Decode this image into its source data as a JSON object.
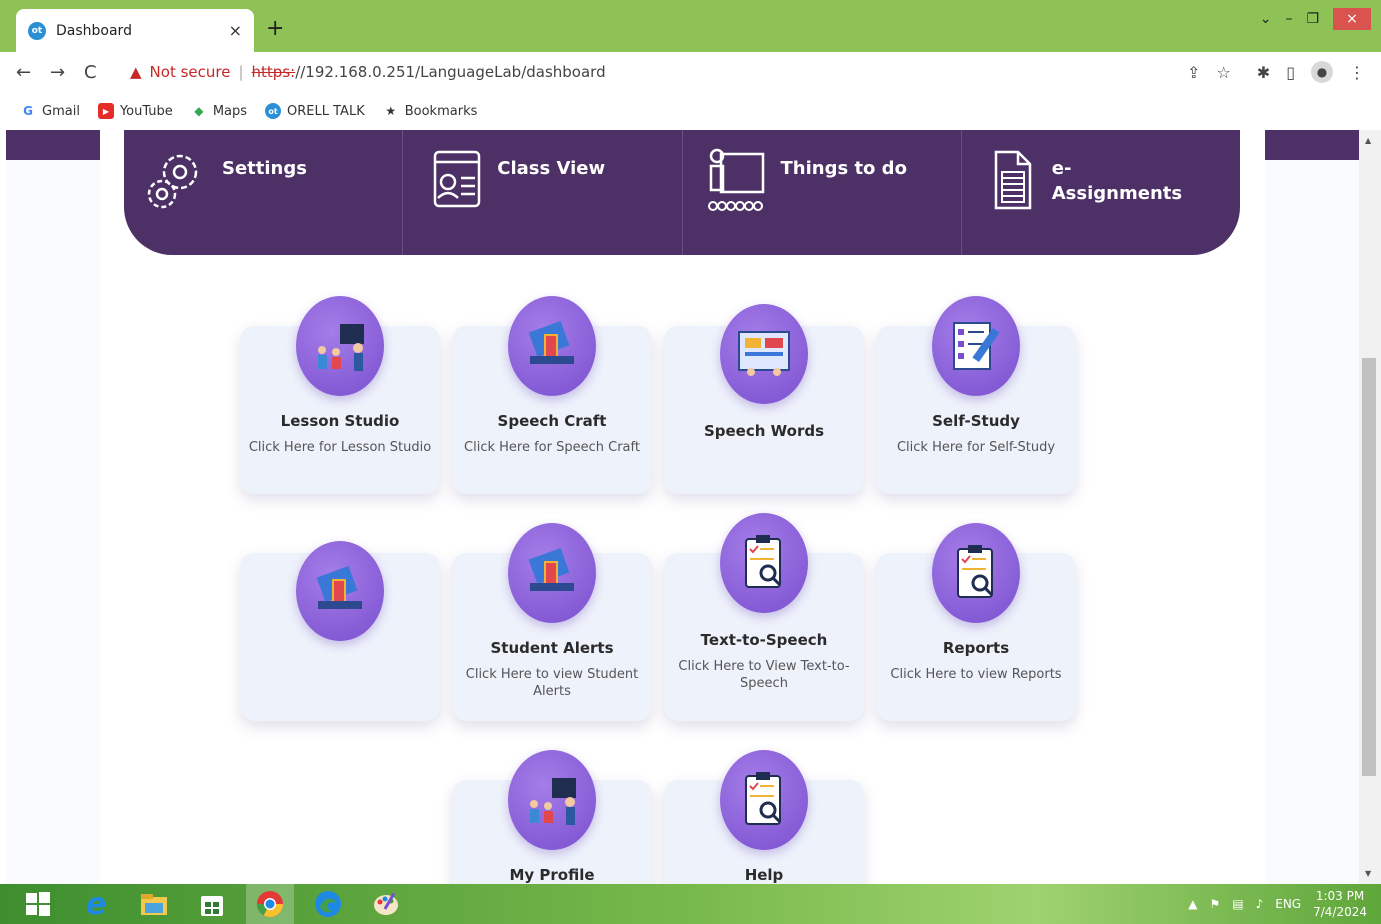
{
  "browser": {
    "tab_title": "Dashboard",
    "tab_close": "×",
    "new_tab": "+",
    "window_controls": {
      "dropdown": "⌄",
      "minimize": "–",
      "restore": "❐",
      "close": "×"
    },
    "url_warning_icon": "▲",
    "not_secure": "Not secure",
    "url_separator": "|",
    "url_scheme": "https:",
    "url_rest": "//192.168.0.251/LanguageLab/dashboard",
    "nav": {
      "back": "←",
      "forward": "→",
      "reload": "C"
    },
    "right_icons": {
      "share": "⇪",
      "star": "☆",
      "extensions": "✱",
      "sidepanel": "▯",
      "menu": "⋮"
    },
    "bookmarks": [
      {
        "label": "Gmail",
        "icon": "G",
        "color": "#4285f4"
      },
      {
        "label": "YouTube",
        "icon": "▶",
        "color": "#e52d27"
      },
      {
        "label": "Maps",
        "icon": "◆",
        "color": "#34a853"
      },
      {
        "label": "ORELL TALK",
        "icon": "ot",
        "color": "#2b8fd6"
      },
      {
        "label": "Bookmarks",
        "icon": "★",
        "color": "#333333"
      }
    ]
  },
  "nav_band": {
    "items": [
      {
        "label": "Settings",
        "icon": "settings-icon"
      },
      {
        "label": "Class View",
        "icon": "class-view-icon"
      },
      {
        "label": "Things to do",
        "icon": "things-to-do-icon"
      },
      {
        "label": "e-Assignments",
        "icon": "e-assignments-icon"
      }
    ]
  },
  "cards": [
    {
      "title": "Lesson Studio",
      "subtitle": "Click Here for Lesson Studio",
      "icon": "lesson-studio-icon"
    },
    {
      "title": "Speech Craft",
      "subtitle": "Click Here for Speech Craft",
      "icon": "speech-craft-icon"
    },
    {
      "title": "Speech Words",
      "subtitle": "",
      "icon": "speech-words-icon"
    },
    {
      "title": "Self-Study",
      "subtitle": "Click Here for Self-Study",
      "icon": "self-study-icon"
    },
    {
      "title": "",
      "subtitle": "",
      "icon": "laptop-door-icon"
    },
    {
      "title": "Student Alerts",
      "subtitle": "Click Here to view Student Alerts",
      "icon": "student-alerts-icon"
    },
    {
      "title": "Text-to-Speech",
      "subtitle": "Click Here to View Text-to-Speech",
      "icon": "text-to-speech-icon"
    },
    {
      "title": "Reports",
      "subtitle": "Click Here to view Reports",
      "icon": "reports-icon"
    },
    {
      "title": "My Profile",
      "subtitle": "",
      "icon": "my-profile-icon"
    },
    {
      "title": "Help",
      "subtitle": "",
      "icon": "help-icon"
    }
  ],
  "taskbar": {
    "apps": [
      "windows-start-icon",
      "internet-explorer-icon",
      "file-explorer-icon",
      "store-icon",
      "chrome-icon",
      "edge-icon",
      "paint-icon"
    ],
    "tray": {
      "arrow": "▲",
      "lang": "ENG",
      "time": "1:03 PM",
      "date": "7/4/2024"
    }
  },
  "colors": {
    "brand_purple": "#4d3166",
    "accent_violet": "#8a5ce0",
    "chrome_green": "#8ec257"
  }
}
